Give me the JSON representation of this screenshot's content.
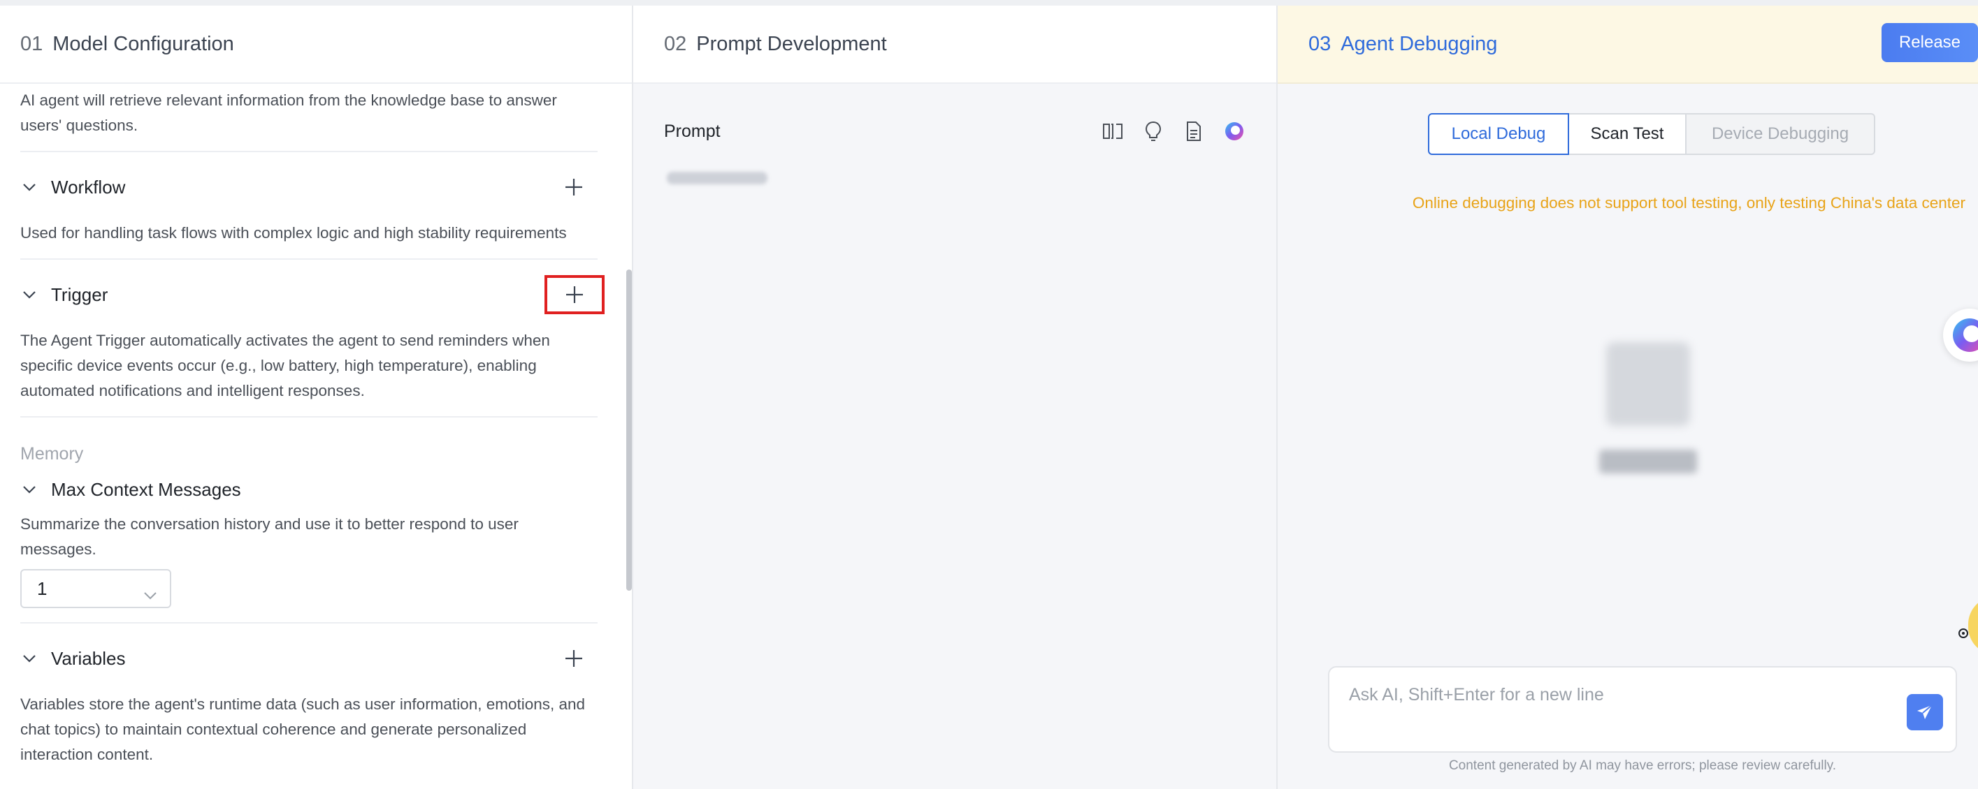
{
  "steps": [
    {
      "num": "01",
      "title": "Model Configuration"
    },
    {
      "num": "02",
      "title": "Prompt Development"
    },
    {
      "num": "03",
      "title": "Agent Debugging"
    }
  ],
  "release_label": "Release",
  "config": {
    "knowledge_desc": "AI agent will retrieve relevant information from the knowledge base to answer users' questions.",
    "workflow": {
      "title": "Workflow",
      "desc": "Used for handling task flows with complex logic and high stability requirements"
    },
    "trigger": {
      "title": "Trigger",
      "desc": "The Agent Trigger automatically activates the agent to send reminders when specific device events occur (e.g., low battery, high temperature), enabling automated notifications and intelligent responses."
    },
    "memory_label": "Memory",
    "max_context": {
      "title": "Max Context Messages",
      "desc": "Summarize the conversation history and use it to better respond to user messages.",
      "value": "1"
    },
    "variables": {
      "title": "Variables",
      "desc": "Variables store the agent's runtime data (such as user information, emotions, and chat topics) to maintain contextual coherence and generate personalized interaction content."
    }
  },
  "prompt": {
    "label": "Prompt"
  },
  "debug": {
    "tabs": [
      "Local Debug",
      "Scan Test",
      "Device Debugging"
    ],
    "active_tab": "Local Debug",
    "warning": "Online debugging does not support tool testing, only testing China's data center",
    "input_placeholder": "Ask AI, Shift+Enter for a new line",
    "disclaimer": "Content generated by AI may have errors; please review carefully."
  },
  "colors": {
    "accent": "#2f6bdb",
    "warning": "#e8a317",
    "highlight": "#e02020"
  }
}
